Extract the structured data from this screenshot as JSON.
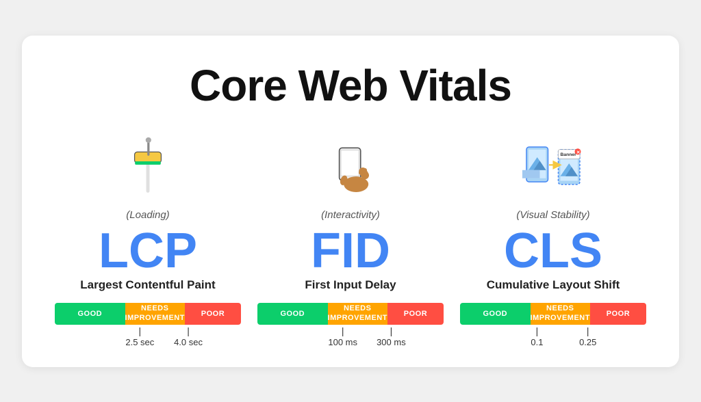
{
  "title": "Core Web Vitals",
  "metrics": [
    {
      "id": "lcp",
      "category": "(Loading)",
      "abbr": "LCP",
      "name": "Largest Contentful Paint",
      "icon": "🖌️",
      "bar": {
        "good_label": "GOOD",
        "needs_label": "NEEDS\nIMPROVEMENT",
        "poor_label": "POOR"
      },
      "tick1": {
        "value": "2.5 sec",
        "position": "38%"
      },
      "tick2": {
        "value": "4.0 sec",
        "position": "67%"
      }
    },
    {
      "id": "fid",
      "category": "(Interactivity)",
      "abbr": "FID",
      "name": "First Input Delay",
      "icon": "📱",
      "bar": {
        "good_label": "GOOD",
        "needs_label": "NEEDS\nIMPROVEMENT",
        "poor_label": "POOR"
      },
      "tick1": {
        "value": "100 ms",
        "position": "38%"
      },
      "tick2": {
        "value": "300 ms",
        "position": "67%"
      }
    },
    {
      "id": "cls",
      "category": "(Visual Stability)",
      "abbr": "CLS",
      "name": "Cumulative Layout Shift",
      "icon": "📐",
      "bar": {
        "good_label": "GOOD",
        "needs_label": "NEEDS\nIMPROVEMENT",
        "poor_label": "POOR"
      },
      "tick1": {
        "value": "0.1",
        "position": "38%"
      },
      "tick2": {
        "value": "0.25",
        "position": "67%"
      }
    }
  ]
}
